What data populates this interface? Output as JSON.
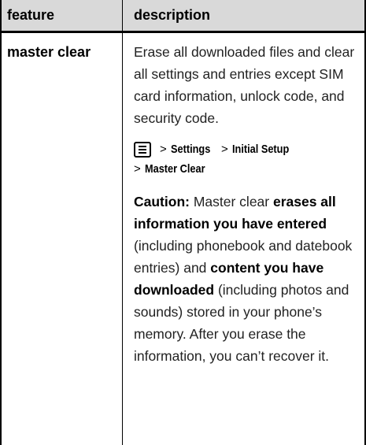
{
  "header": {
    "feature_label": "feature",
    "description_label": "description"
  },
  "row": {
    "feature": "master clear",
    "description": "Erase all downloaded files and clear all settings and entries except SIM card information, unlock code, and security code.",
    "path": {
      "icon": "menu-key-icon",
      "separator": ">",
      "line1": [
        "Settings",
        "Initial Setup"
      ],
      "line2": [
        "Master Clear"
      ]
    },
    "caution": {
      "label": "Caution:",
      "t1": " Master clear ",
      "b1": "erases all information you have entered",
      "t2": " (including phonebook and datebook entries) and ",
      "b2": "content you have downloaded",
      "t3": " (including photos and sounds) stored in your phone’s memory. After you erase the information, you can’t recover it."
    }
  }
}
